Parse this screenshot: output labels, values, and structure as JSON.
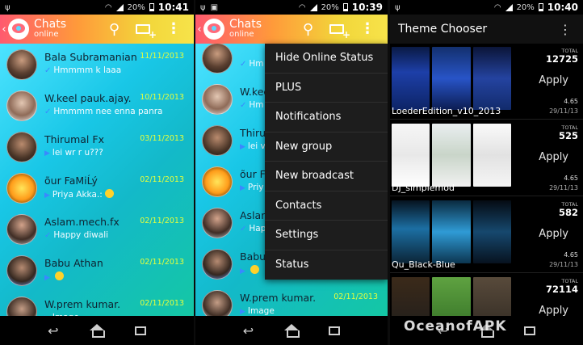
{
  "panels": [
    {
      "status": {
        "battery": "20%",
        "time": "10:41"
      },
      "actionbar": {
        "title": "Chats",
        "subtitle": "online"
      },
      "chats": [
        {
          "name": "Bala Subramanian",
          "date": "11/11/2013",
          "message": "Hmmmm k laaa",
          "prefix": "tick"
        },
        {
          "name": "W.keel pauk.ajay.",
          "date": "10/11/2013",
          "message": "Hmmmm nee enna panra",
          "prefix": "tick"
        },
        {
          "name": "Thirumal Fx",
          "date": "03/11/2013",
          "message": "lei wr r u???",
          "prefix": "tri"
        },
        {
          "name": "õur FaMiĹý",
          "date": "02/11/2013",
          "message": "Priya Akka.:",
          "prefix": "tri",
          "emoji": true
        },
        {
          "name": "Aslam.mech.fx",
          "date": "02/11/2013",
          "message": "Happy diwali",
          "prefix": "tick"
        },
        {
          "name": "Babu Athan",
          "date": "02/11/2013",
          "message": "",
          "prefix": "tri",
          "emoji": true
        },
        {
          "name": "W.prem kumar.",
          "date": "02/11/2013",
          "message": "Image",
          "prefix": "tri"
        }
      ]
    },
    {
      "status": {
        "battery": "20%",
        "time": "10:39"
      },
      "actionbar": {
        "title": "Chats",
        "subtitle": "online"
      },
      "chats": [
        {
          "name": "",
          "date": "",
          "message": "Hm",
          "prefix": "tick"
        },
        {
          "name": "W.kee",
          "date": "",
          "message": "Hm",
          "prefix": "tick"
        },
        {
          "name": "Thiru",
          "date": "",
          "message": "lei v",
          "prefix": "tri"
        },
        {
          "name": "õur F",
          "date": "",
          "message": "Priy",
          "prefix": "tri"
        },
        {
          "name": "Aslan",
          "date": "",
          "message": "Hap",
          "prefix": "tick"
        },
        {
          "name": "Babu",
          "date": "",
          "message": "",
          "prefix": "tri",
          "emoji": true
        },
        {
          "name": "W.prem kumar.",
          "date": "02/11/2013",
          "message": "Image",
          "prefix": "tri"
        }
      ],
      "menu": [
        "Hide Online Status",
        "PLUS",
        "Notifications",
        "New group",
        "New broadcast",
        "Contacts",
        "Settings",
        "Status"
      ]
    },
    {
      "status": {
        "battery": "20%",
        "time": "10:40"
      },
      "header": {
        "title": "Theme Chooser"
      },
      "themes": [
        {
          "name": "LoederEdition_v10_2013",
          "total_label": "TOTAL",
          "total": "12725",
          "apply": "Apply",
          "rating": "4.65",
          "date": "29/11/13",
          "style": "blue"
        },
        {
          "name": "DJ_simplemod",
          "total_label": "TOTAL",
          "total": "525",
          "apply": "Apply",
          "rating": "4.65",
          "date": "29/11/13",
          "style": "white"
        },
        {
          "name": "Qu_Black-Blue",
          "total_label": "TOTAL",
          "total": "582",
          "apply": "Apply",
          "rating": "4.65",
          "date": "29/11/13",
          "style": "black"
        },
        {
          "name": "",
          "total_label": "TOTAL",
          "total": "72114",
          "apply": "Apply",
          "rating": "",
          "date": "",
          "style": "mix"
        }
      ]
    }
  ],
  "watermark": "OceanofAPK"
}
